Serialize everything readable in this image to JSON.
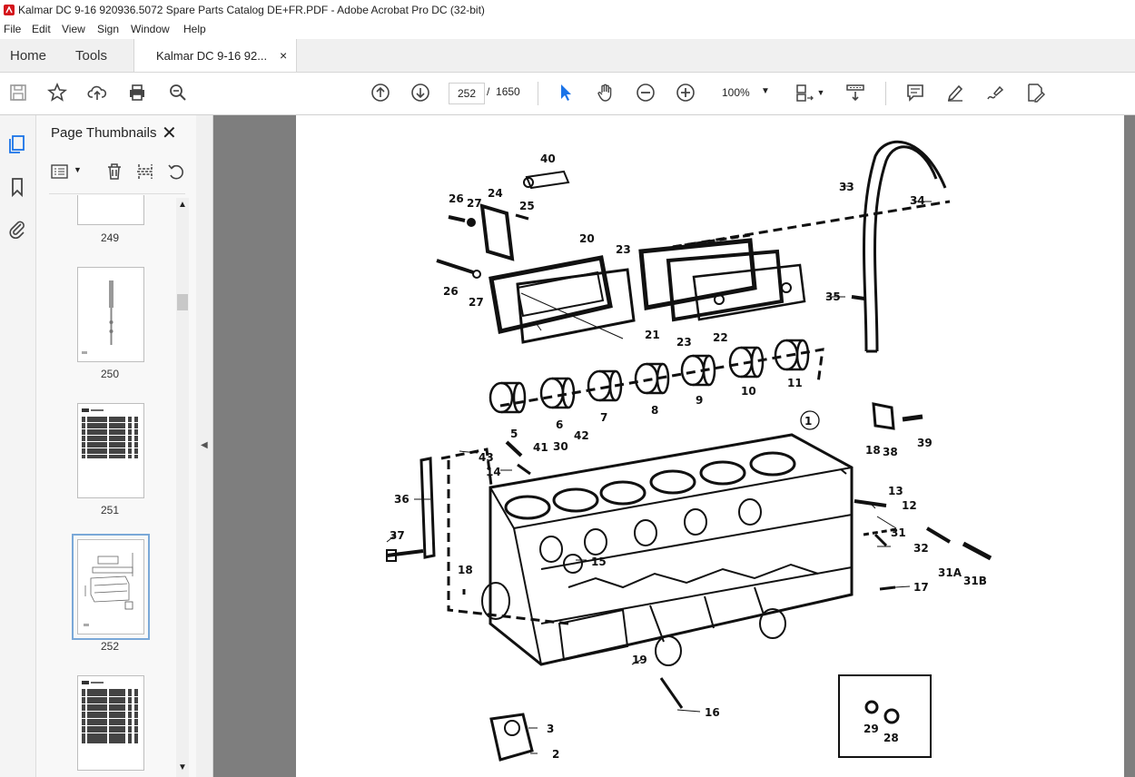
{
  "window": {
    "title": "Kalmar DC 9-16 920936.5072 Spare Parts Catalog DE+FR.PDF - Adobe Acrobat Pro DC (32-bit)"
  },
  "menu": [
    "File",
    "Edit",
    "View",
    "Sign",
    "Window",
    "Help"
  ],
  "tabs": {
    "home": "Home",
    "tools": "Tools",
    "document": "Kalmar DC 9-16 92...",
    "close": "×"
  },
  "toolbar": {
    "page_current": "252",
    "page_sep": "/",
    "page_total": "1650",
    "zoom": "100%"
  },
  "panel": {
    "title": "Page Thumbnails",
    "close": "✕",
    "thumbnails": [
      {
        "label": "249"
      },
      {
        "label": "250"
      },
      {
        "label": "251"
      },
      {
        "label": "252",
        "selected": true
      },
      {
        "label": ""
      }
    ]
  },
  "drawing": {
    "labels": [
      "40",
      "26",
      "27",
      "24",
      "25",
      "33",
      "34",
      "20",
      "23",
      "26",
      "27",
      "21",
      "23",
      "22",
      "35",
      "5",
      "6",
      "7",
      "8",
      "9",
      "10",
      "11",
      "1",
      "43",
      "41",
      "30",
      "42",
      "14",
      "18",
      "38",
      "39",
      "13",
      "12",
      "36",
      "31",
      "37",
      "32",
      "15",
      "31A",
      "31B",
      "18",
      "17",
      "19",
      "16",
      "3",
      "2",
      "29",
      "28"
    ]
  }
}
